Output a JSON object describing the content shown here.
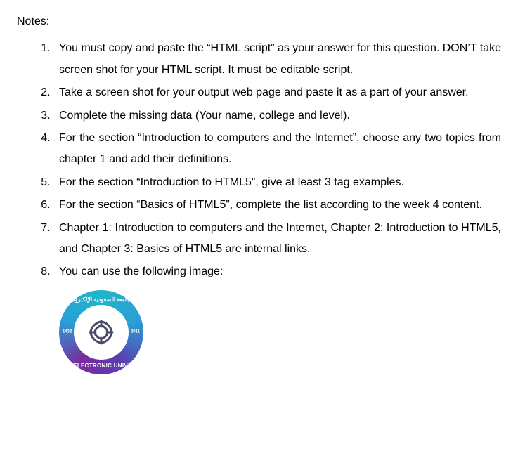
{
  "notes_label": "Notes:",
  "items": [
    "You must copy and paste the “HTML script” as your answer for this question. DON’T take screen shot for your HTML script. It must be editable script.",
    "Take a screen shot for your output web page and paste it as a part of your answer.",
    "Complete the missing data (Your name, college and level).",
    "For the section “Introduction to computers and the Internet”, choose any two topics from chapter 1 and add their definitions.",
    "For the section “Introduction to HTML5”, give at least 3 tag examples.",
    "For the section “Basics of HTML5”, complete the list according to the week 4 content.",
    "Chapter 1: Introduction to computers and the Internet, Chapter 2: Introduction to HTML5, and Chapter 3: Basics of HTML5 are internal links.",
    "You can use the following image:"
  ],
  "logo": {
    "arabic_text": "الجامعة السعودية الإلكترونية",
    "english_text": "SAUDI ELECTRONIC UNIVERSITY",
    "year_left": "1432",
    "year_right": "2011"
  }
}
